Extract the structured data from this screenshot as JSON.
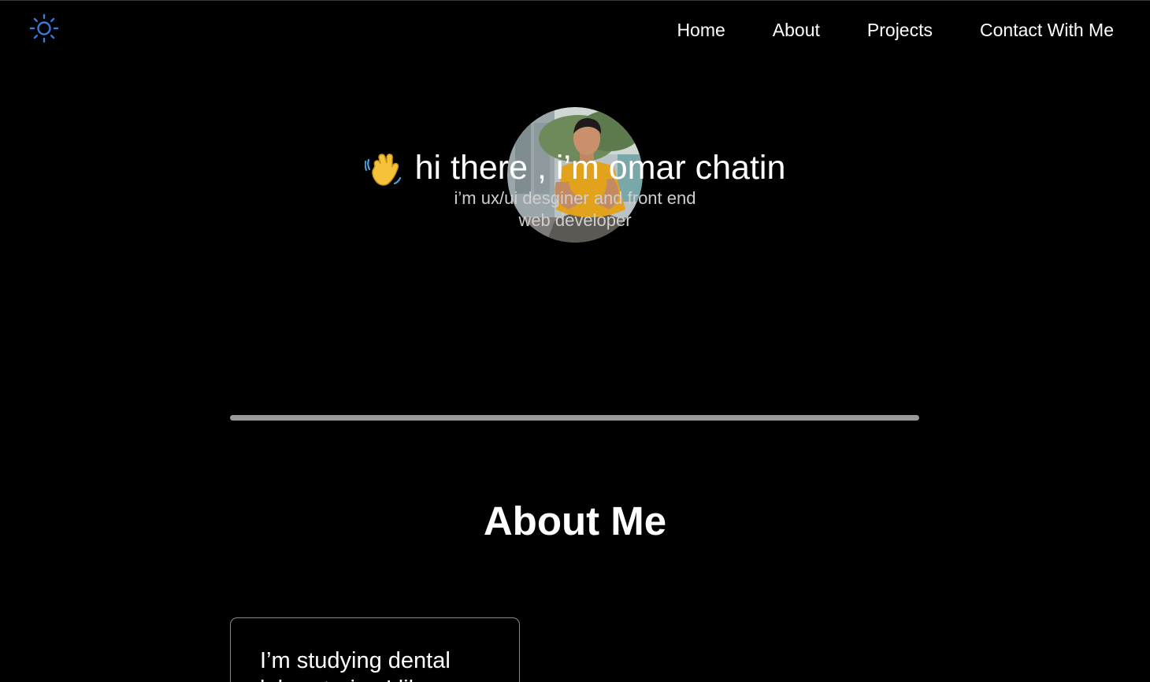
{
  "nav": {
    "items": [
      {
        "label": "Home"
      },
      {
        "label": "About"
      },
      {
        "label": "Projects"
      },
      {
        "label": "Contact With Me"
      }
    ]
  },
  "theme_toggle": {
    "icon": "sun-icon",
    "color": "#3b7bd9"
  },
  "hero": {
    "avatar_icon": "profile-photo",
    "wave_icon": "waving-hand-emoji",
    "title": "hi there , i’m omar chatin",
    "subtitle_line1": "i’m ux/ui desginer and front end",
    "subtitle_line2": "web developer"
  },
  "about": {
    "title": "About Me",
    "card_text": "I’m studying dental laboratories I like"
  },
  "colors": {
    "background": "#000000",
    "text": "#ffffff",
    "subtitle": "#cfcfcf",
    "divider": "#9a9a9a",
    "accent": "#3b7bd9"
  }
}
